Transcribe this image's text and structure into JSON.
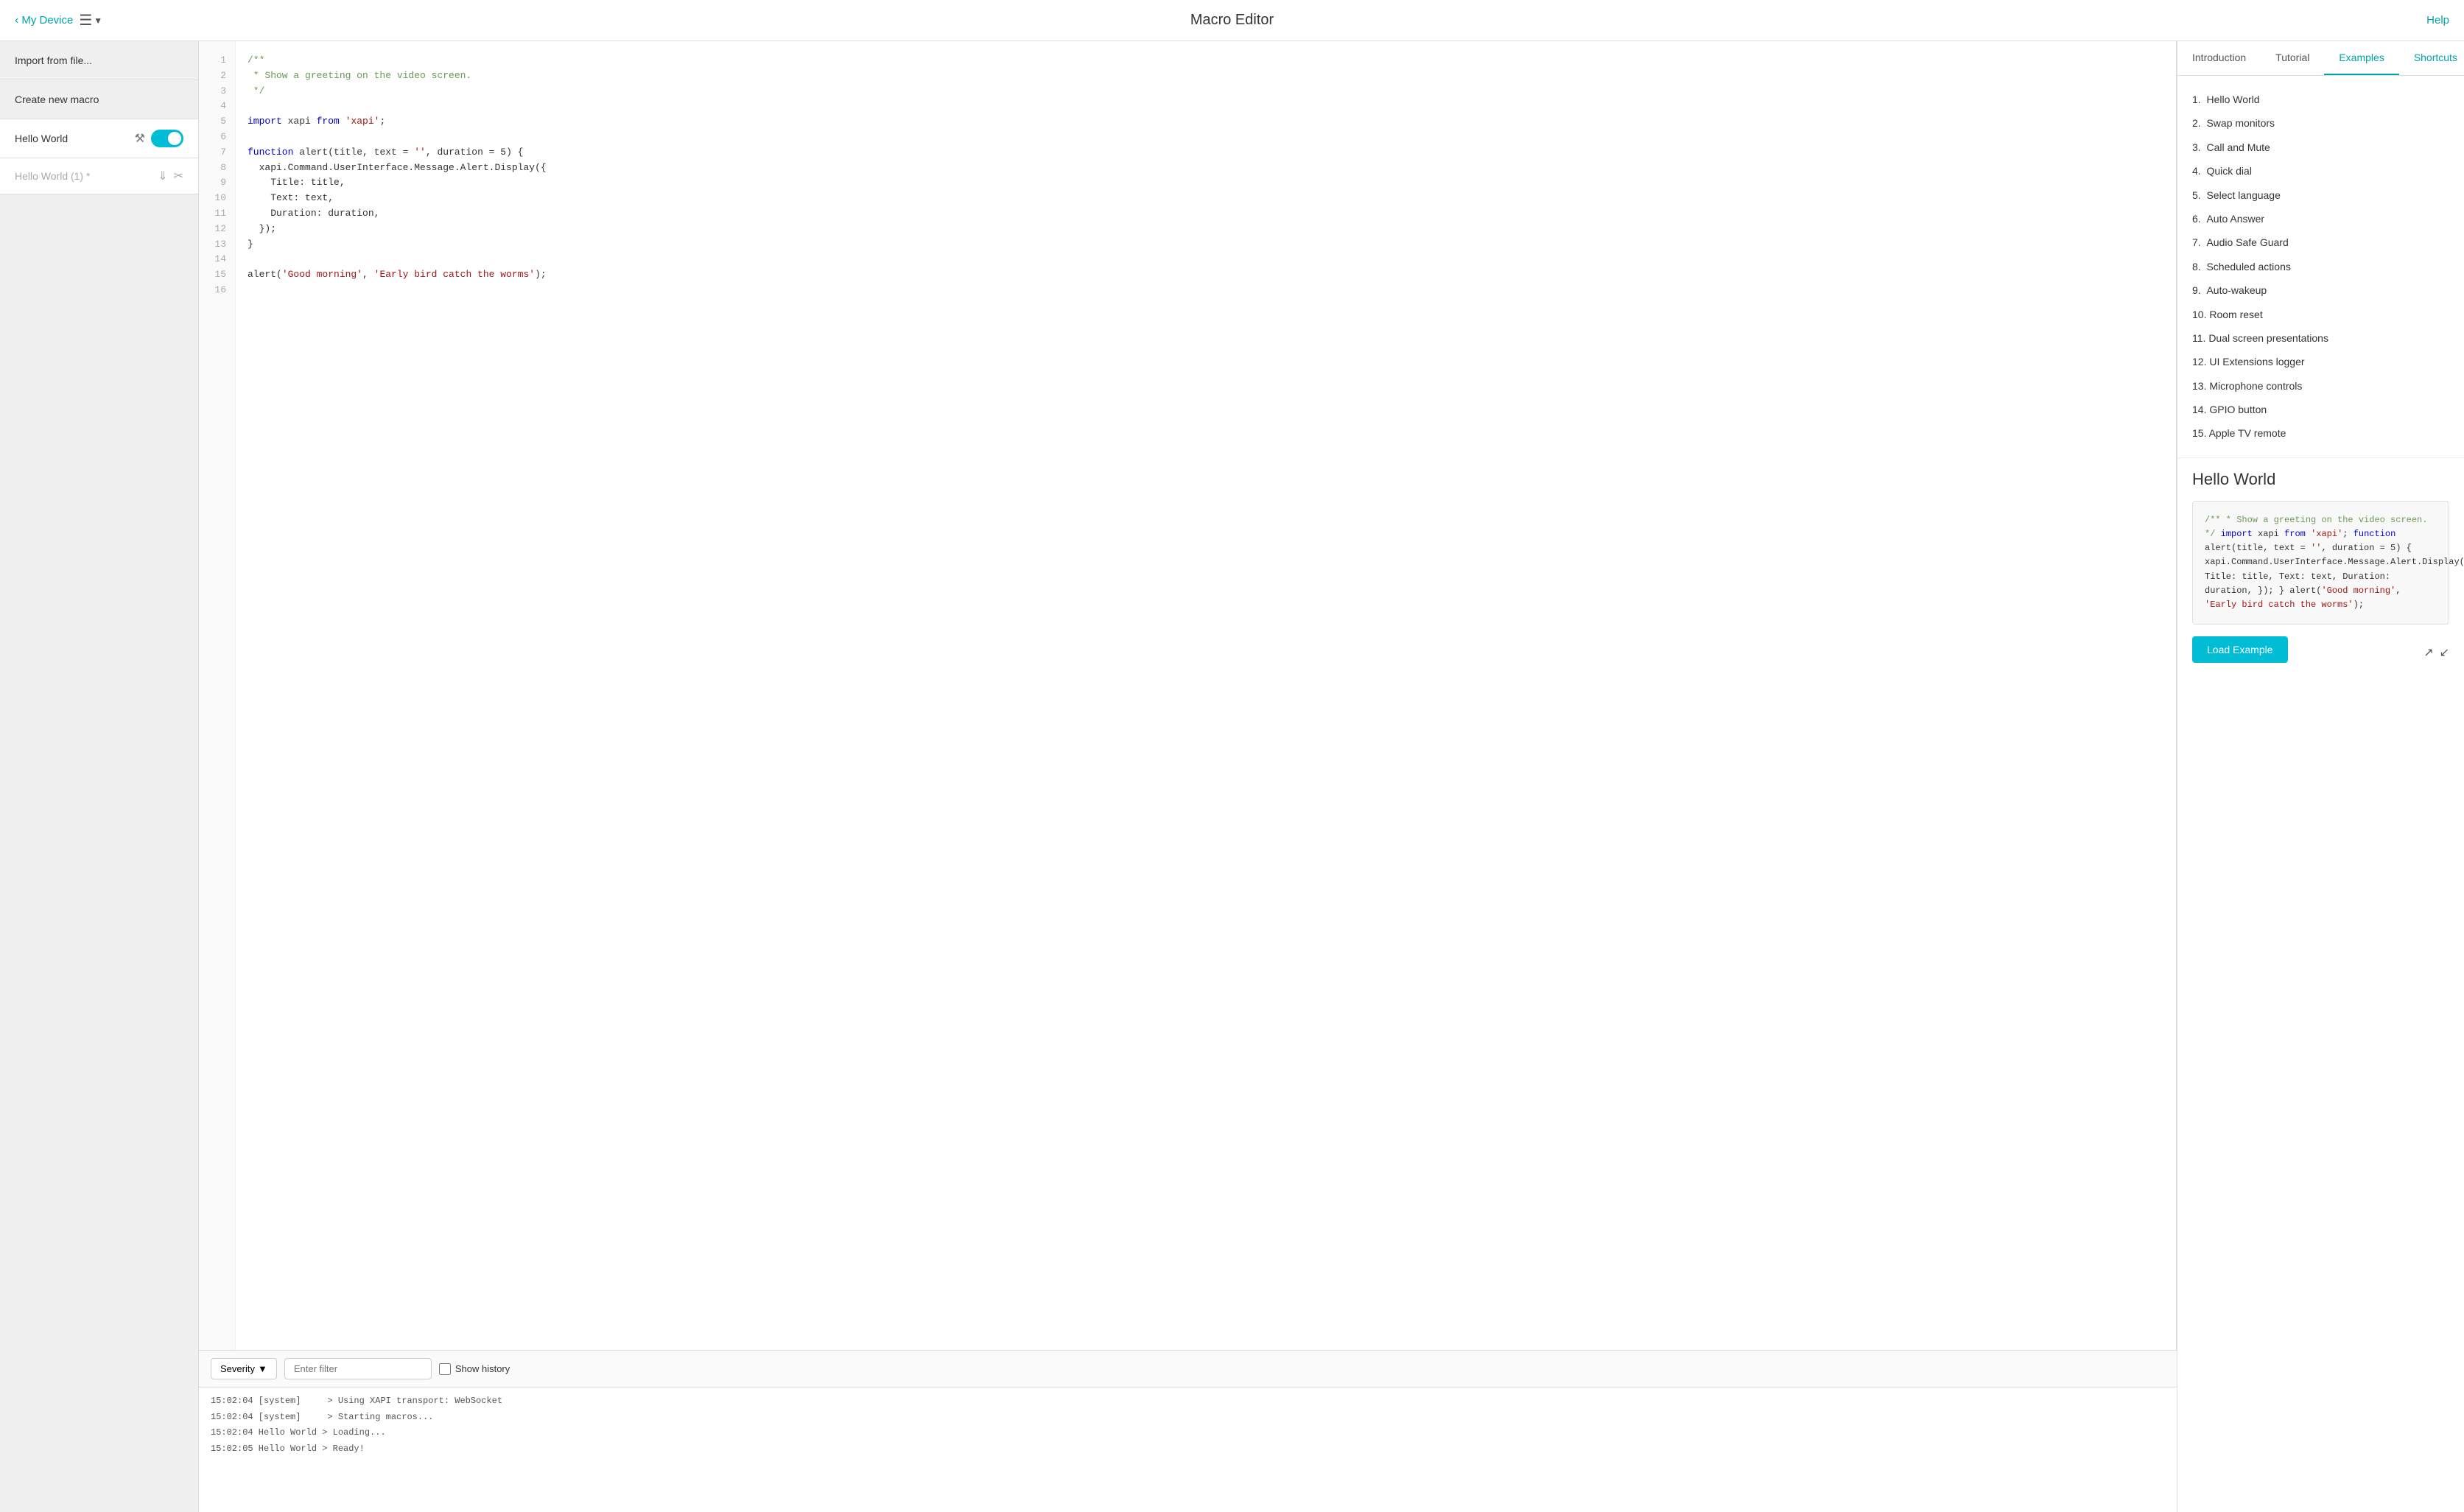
{
  "topbar": {
    "back_text": "My Device",
    "title": "Macro Editor",
    "help_label": "Help",
    "menu_icon": "☰"
  },
  "sidebar": {
    "import_label": "Import from file...",
    "create_label": "Create new macro",
    "macros": [
      {
        "name": "Hello World",
        "active": true,
        "enabled": true
      },
      {
        "name": "Hello World (1) *",
        "active": false,
        "enabled": false,
        "draft": true
      }
    ]
  },
  "editor": {
    "lines": [
      {
        "num": 1,
        "content": "/**",
        "type": "comment"
      },
      {
        "num": 2,
        "content": " * Show a greeting on the video screen.",
        "type": "comment"
      },
      {
        "num": 3,
        "content": " */",
        "type": "comment"
      },
      {
        "num": 4,
        "content": "",
        "type": "normal"
      },
      {
        "num": 5,
        "content": "import xapi from 'xapi';",
        "type": "import"
      },
      {
        "num": 6,
        "content": "",
        "type": "normal"
      },
      {
        "num": 7,
        "content": "function alert(title, text = '', duration = 5) {",
        "type": "normal"
      },
      {
        "num": 8,
        "content": "  xapi.Command.UserInterface.Message.Alert.Display({",
        "type": "normal"
      },
      {
        "num": 9,
        "content": "    Title: title,",
        "type": "normal"
      },
      {
        "num": 10,
        "content": "    Text: text,",
        "type": "normal"
      },
      {
        "num": 11,
        "content": "    Duration: duration,",
        "type": "normal"
      },
      {
        "num": 12,
        "content": "  });",
        "type": "normal"
      },
      {
        "num": 13,
        "content": "}",
        "type": "normal"
      },
      {
        "num": 14,
        "content": "",
        "type": "normal"
      },
      {
        "num": 15,
        "content": "alert('Good morning', 'Early bird catch the worms');",
        "type": "string_line"
      },
      {
        "num": 16,
        "content": "",
        "type": "normal"
      }
    ]
  },
  "log": {
    "severity_label": "Severity",
    "filter_placeholder": "Enter filter",
    "show_history_label": "Show history",
    "entries": [
      {
        "time": "15:02:04",
        "source": "[system]",
        "message": "> Using XAPI transport: WebSocket"
      },
      {
        "time": "15:02:04",
        "source": "[system]",
        "message": "> Starting macros..."
      },
      {
        "time": "15:02:04",
        "source": "Hello World",
        "message": "> Loading..."
      },
      {
        "time": "15:02:05",
        "source": "Hello World",
        "message": "> Ready!"
      }
    ]
  },
  "right_panel": {
    "tabs": [
      {
        "id": "introduction",
        "label": "Introduction"
      },
      {
        "id": "tutorial",
        "label": "Tutorial"
      },
      {
        "id": "examples",
        "label": "Examples",
        "active": true
      },
      {
        "id": "shortcuts",
        "label": "Shortcuts"
      }
    ],
    "examples": [
      {
        "num": "1.",
        "name": "Hello World"
      },
      {
        "num": "2.",
        "name": "Swap monitors"
      },
      {
        "num": "3.",
        "name": "Call and Mute"
      },
      {
        "num": "4.",
        "name": "Quick dial"
      },
      {
        "num": "5.",
        "name": "Select language"
      },
      {
        "num": "6.",
        "name": "Auto Answer"
      },
      {
        "num": "7.",
        "name": "Audio Safe Guard"
      },
      {
        "num": "8.",
        "name": "Scheduled actions"
      },
      {
        "num": "9.",
        "name": "Auto-wakeup"
      },
      {
        "num": "10.",
        "name": "Room reset"
      },
      {
        "num": "11.",
        "name": "Dual screen presentations"
      },
      {
        "num": "12.",
        "name": "UI Extensions logger"
      },
      {
        "num": "13.",
        "name": "Microphone controls"
      },
      {
        "num": "14.",
        "name": "GPIO button"
      },
      {
        "num": "15.",
        "name": "Apple TV remote"
      }
    ],
    "hello_world": {
      "title": "Hello World",
      "code_comment1": "/**",
      "code_comment2": " * Show a greeting on the video screen.",
      "code_comment3": " */",
      "code_import": "import xapi from 'xapi';",
      "code_func": "function alert(title, text = '', duration = 5) {",
      "code_body1": "  xapi.Command.UserInterface.Message.Alert.Display({",
      "code_body2": "    Title: title,",
      "code_body3": "    Text: text,",
      "code_body4": "    Duration: duration,",
      "code_body5": "  });",
      "code_close": "}",
      "code_call_pre": "alert(",
      "code_call_str1": "'Good morning'",
      "code_call_comma": ", ",
      "code_call_str2": "'Early bird catch the worms'",
      "code_call_post": ");",
      "load_btn": "Load Example"
    },
    "colors": {
      "active_tab": "#00a3a8",
      "comment": "#6a9955",
      "string": "#a31515",
      "keyword": "#0000cc"
    }
  }
}
